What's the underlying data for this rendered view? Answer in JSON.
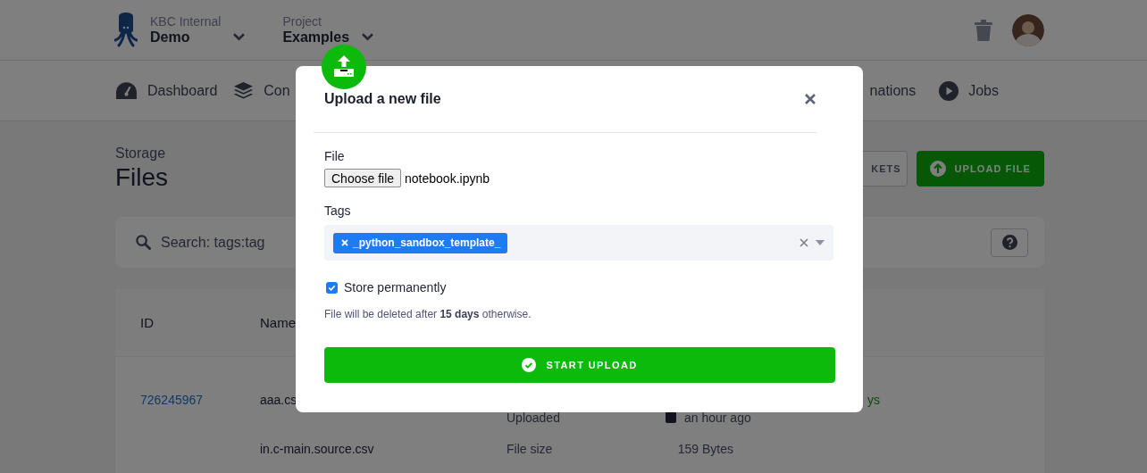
{
  "header": {
    "organization": {
      "label": "KBC Internal",
      "value": "Demo"
    },
    "project": {
      "label": "Project",
      "value": "Examples"
    }
  },
  "nav": {
    "left": [
      "Dashboard",
      "Con"
    ],
    "right": [
      "nations",
      "Jobs"
    ]
  },
  "page": {
    "breadcrumb": "Storage",
    "title": "Files",
    "actions": [
      {
        "label": "KETS",
        "kind": "outline"
      },
      {
        "label": "UPLOAD FILE",
        "kind": "primary"
      }
    ],
    "search": {
      "placeholder": "Search: tags:tag"
    },
    "table": {
      "columns": [
        "ID",
        "Name"
      ],
      "rows": [
        {
          "id": "726245967",
          "name": "aaa.cs",
          "detail_label": "Uploaded",
          "detail_value": "an hour ago",
          "status": "ys"
        },
        {
          "name": "in.c-main.source.csv",
          "detail_label": "File size",
          "detail_value": "159 Bytes"
        }
      ]
    }
  },
  "modal": {
    "title": "Upload a new file",
    "file": {
      "label": "File",
      "button": "Choose file",
      "value": "notebook.ipynb"
    },
    "tags": {
      "label": "Tags",
      "items": [
        "_python_sandbox_template_"
      ]
    },
    "store": {
      "label": "Store permanently",
      "checked": true
    },
    "note": "File will be deleted after **15 days** otherwise.",
    "submit": "START UPLOAD"
  }
}
